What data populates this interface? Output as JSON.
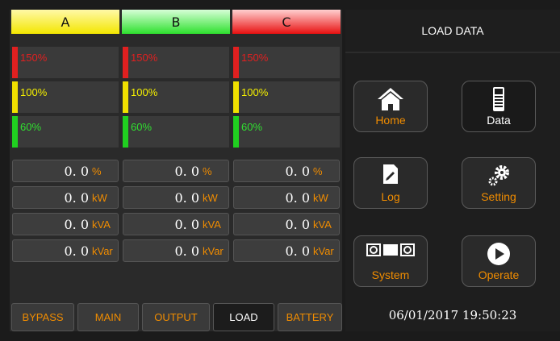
{
  "phases": [
    "A",
    "B",
    "C"
  ],
  "bar_levels": [
    {
      "label": "150%",
      "strip_color": "#e02020",
      "text_color": "#e02020"
    },
    {
      "label": "100%",
      "strip_color": "#f0e000",
      "text_color": "#f5f000"
    },
    {
      "label": "60%",
      "strip_color": "#20d020",
      "text_color": "#30e030"
    }
  ],
  "readings": [
    {
      "value": "0. 0",
      "unit": "%"
    },
    {
      "value": "0. 0",
      "unit": "kW"
    },
    {
      "value": "0. 0",
      "unit": "kVA"
    },
    {
      "value": "0. 0",
      "unit": "kVar"
    }
  ],
  "tabs": [
    {
      "label": "BYPASS",
      "active": false
    },
    {
      "label": "MAIN",
      "active": false
    },
    {
      "label": "OUTPUT",
      "active": false
    },
    {
      "label": "LOAD",
      "active": true
    },
    {
      "label": "BATTERY",
      "active": false
    }
  ],
  "panel_title": "LOAD DATA",
  "nav": {
    "home": {
      "label": "Home",
      "icon": "home-icon"
    },
    "data": {
      "label": "Data",
      "icon": "data-icon"
    },
    "log": {
      "label": "Log",
      "icon": "log-icon"
    },
    "setting": {
      "label": "Setting",
      "icon": "gears-icon"
    },
    "system": {
      "label": "System",
      "icon": "system-icon"
    },
    "operate": {
      "label": "Operate",
      "icon": "play-icon"
    }
  },
  "datetime": "06/01/2017  19:50:23",
  "colors": {
    "accent": "#f08c00",
    "phase_a": "#f3e600",
    "phase_b": "#2ee02e",
    "phase_c": "#e81010"
  }
}
